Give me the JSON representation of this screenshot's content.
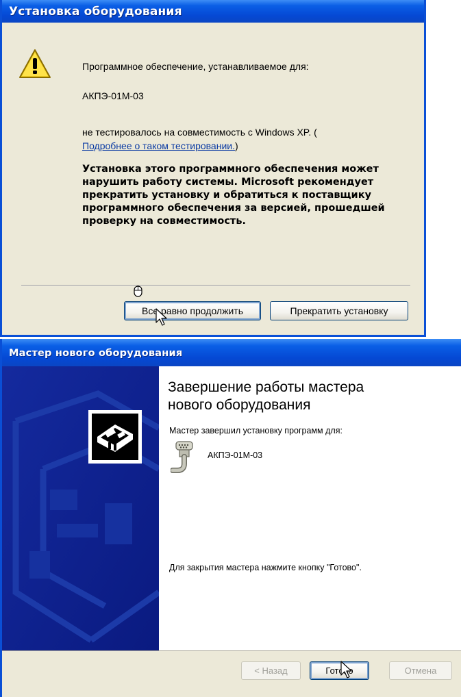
{
  "dialog1": {
    "title": "Установка оборудования",
    "icon": "warning-icon",
    "software_for_label": "Программное обеспечение, устанавливаемое для:",
    "device_name": "АКПЭ-01М-03",
    "not_tested_text": "не тестировалось на совместимость с Windows XP. (",
    "link_text": "Подробнее о таком тестировании.",
    "link_close": ")",
    "warning_lines": [
      "Установка этого программного обеспечения может",
      "нарушить работу системы. Microsoft рекомендует",
      "прекратить установку и обратиться к поставщику",
      "программного обеспечения за версией, прошедшей",
      "проверку на совместимость."
    ],
    "continue_button": "Все равно продолжить",
    "stop_button": "Прекратить установку"
  },
  "dialog2": {
    "title": "Мастер нового оборудования",
    "heading_lines": [
      "Завершение работы мастера",
      "нового оборудования"
    ],
    "completed_text": "Мастер завершил установку программ для:",
    "device_name": "АКПЭ-01М-03",
    "close_instruction": "Для закрытия мастера нажмите кнопку \"Готово\".",
    "back_button": "< Назад",
    "finish_button": "Готово",
    "cancel_button": "Отмена"
  },
  "colors": {
    "titlebar_blue": "#0548d4",
    "dialog_face": "#ece9d8",
    "wizard_panel": "#0c1d8c",
    "link": "#0b3ba3"
  }
}
